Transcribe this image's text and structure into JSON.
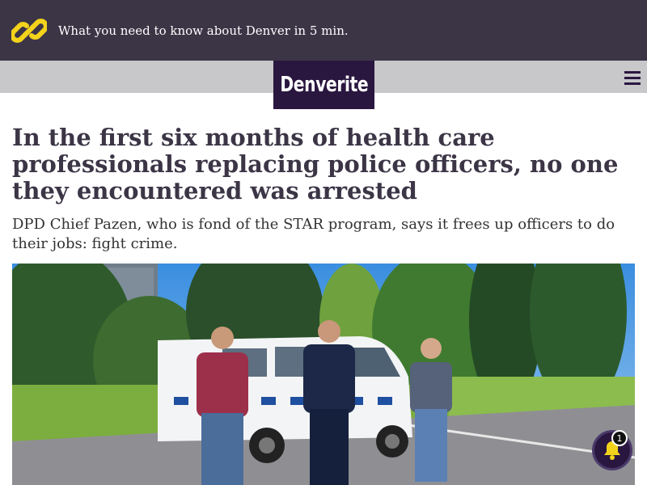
{
  "promo": {
    "text": "What you need to know about Denver in 5 min.",
    "icon": "link-icon",
    "icon_color": "#f3d21b"
  },
  "nav": {
    "logo_text": "Denverite",
    "menu_icon": "hamburger-menu-icon"
  },
  "article": {
    "headline": "In the first six months of health care professionals replacing police officers, no one they encountered was arrested",
    "dek": "DPD Chief Pazen, who is fond of the STAR program, says it frees up officers to do their jobs: fight crime."
  },
  "notifications": {
    "icon": "bell-icon",
    "badge_count": "1"
  },
  "colors": {
    "promo_bg": "#3c3546",
    "brand": "#2a1740",
    "nav_bg": "#c8c7ca",
    "headline": "#3c3546"
  }
}
